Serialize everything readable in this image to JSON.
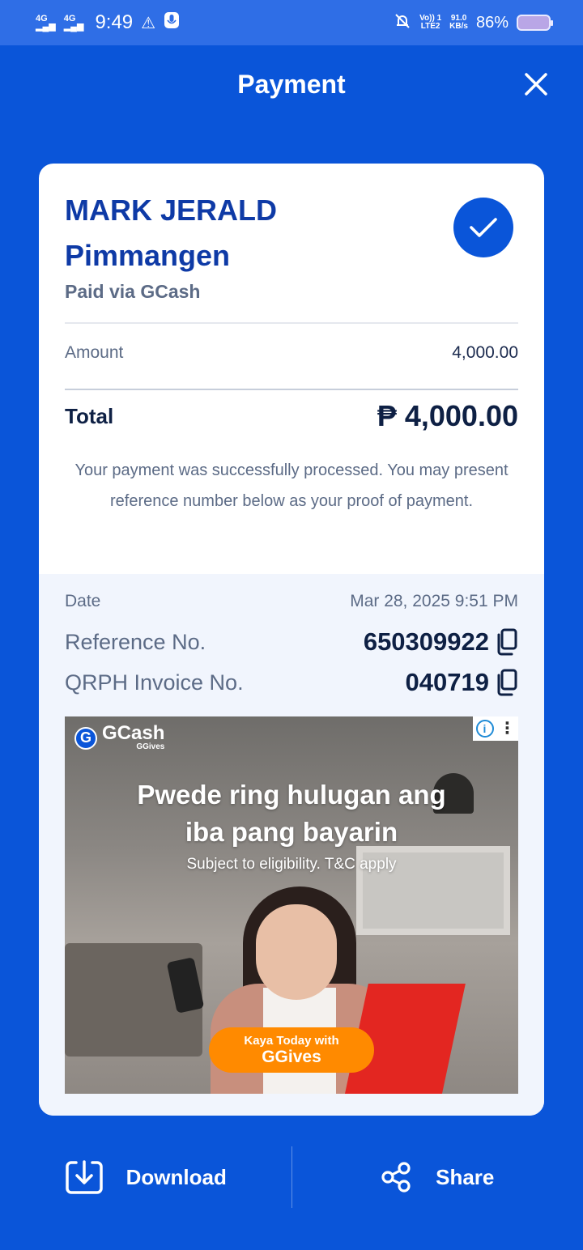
{
  "status_bar": {
    "signal1": "4G",
    "signal2": "4G",
    "time": "9:49",
    "volte": "Vo)) 1",
    "lte": "LTE2",
    "speed_value": "91.0",
    "speed_unit": "KB/s",
    "battery": "86%"
  },
  "header": {
    "title": "Payment"
  },
  "receipt": {
    "merchant_line1": "MARK JERALD",
    "merchant_line2": "Pimmangen",
    "paid_via": "Paid via GCash",
    "amount_label": "Amount",
    "amount_value": "4,000.00",
    "total_label": "Total",
    "currency_symbol": "₱",
    "total_value": "4,000.00",
    "message": "Your payment was successfully processed. You may present reference number below as your proof of payment.",
    "date_label": "Date",
    "date_value": "Mar 28, 2025 9:51 PM",
    "reference_label": "Reference No.",
    "reference_value": "650309922",
    "invoice_label": "QRPH Invoice No.",
    "invoice_value": "040719"
  },
  "ad": {
    "brand": "GCash",
    "brand_sub": "GGives",
    "headline_line1": "Pwede ring hulugan ang",
    "headline_line2": "iba pang bayarin",
    "subtext": "Subject to eligibility. T&C apply",
    "cta_line1": "Kaya Today with",
    "cta_line2": "GGives"
  },
  "actions": {
    "download_label": "Download",
    "share_label": "Share"
  },
  "colors": {
    "primary": "#0a55d9",
    "text_dark": "#0e2044",
    "muted": "#5c6b86",
    "details_bg": "#f1f5fd",
    "cta_orange": "#ff8a00"
  }
}
